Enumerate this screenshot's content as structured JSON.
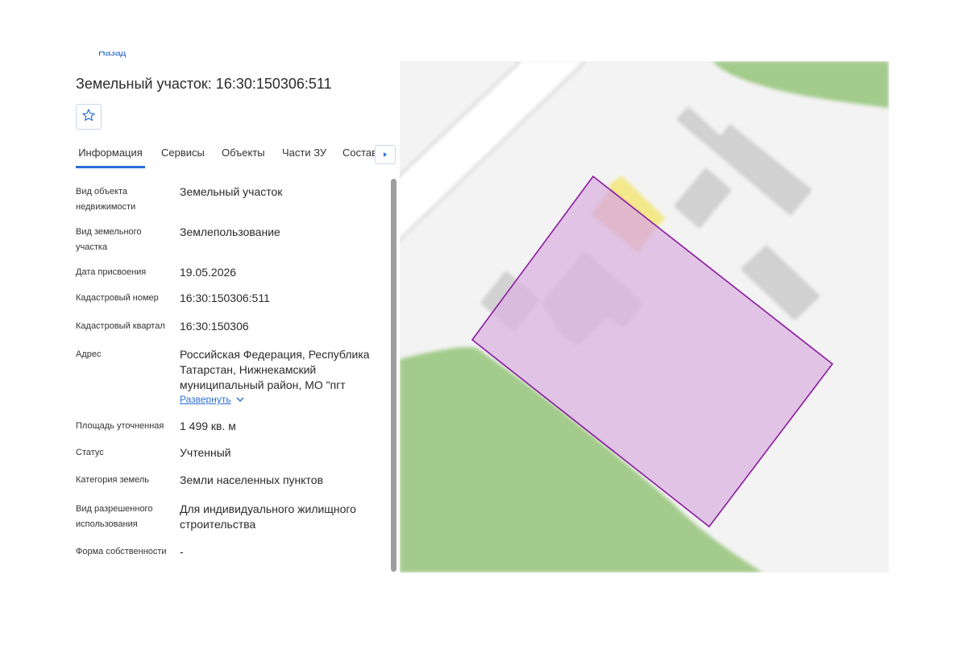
{
  "header": {
    "top_link_text": "Назад",
    "title": "Земельный участок: 16:30:150306:511"
  },
  "favorite": {
    "icon": "star-outline-icon"
  },
  "tabs": [
    {
      "label": "Информация",
      "active": true
    },
    {
      "label": "Сервисы",
      "active": false
    },
    {
      "label": "Объекты",
      "active": false
    },
    {
      "label": "Части ЗУ",
      "active": false
    },
    {
      "label": "Состав",
      "active": false
    }
  ],
  "tabs_scroll_icon": "caret-right-icon",
  "info": {
    "rows": [
      {
        "label": "Вид объекта недвижимости",
        "value": "Земельный участок"
      },
      {
        "label": "Вид земельного участка",
        "value": "Землепользование"
      },
      {
        "label": "Дата присвоения",
        "value": "19.05.2026"
      },
      {
        "label": "Кадастровый номер",
        "value": "16:30:150306:511"
      },
      {
        "label": "Кадастровый квартал",
        "value": "16:30:150306"
      },
      {
        "label": "Адрес",
        "value": "Российская Федерация, Республика Татарстан, Нижнекамский муниципальный район, МО \"пгт"
      },
      {
        "label": "Площадь уточненная",
        "value": "1 499 кв. м"
      },
      {
        "label": "Статус",
        "value": "Учтенный"
      },
      {
        "label": "Категория земель",
        "value": "Земли населенных пунктов"
      },
      {
        "label": "Вид разрешенного использования",
        "value": "Для индивидуального жилищного строительства"
      },
      {
        "label": "Форма собственности",
        "value": "-"
      }
    ],
    "expand_label": "Развернуть"
  },
  "colors": {
    "accent": "#2d6fd6",
    "parcel_fill": "#d9b3e0",
    "parcel_stroke": "#8a1aa0",
    "green_area": "#a3cb8b",
    "building": "#d4d4d4",
    "highlight_building": "#f2c38a",
    "highlight_yellow": "#f3e98a"
  }
}
